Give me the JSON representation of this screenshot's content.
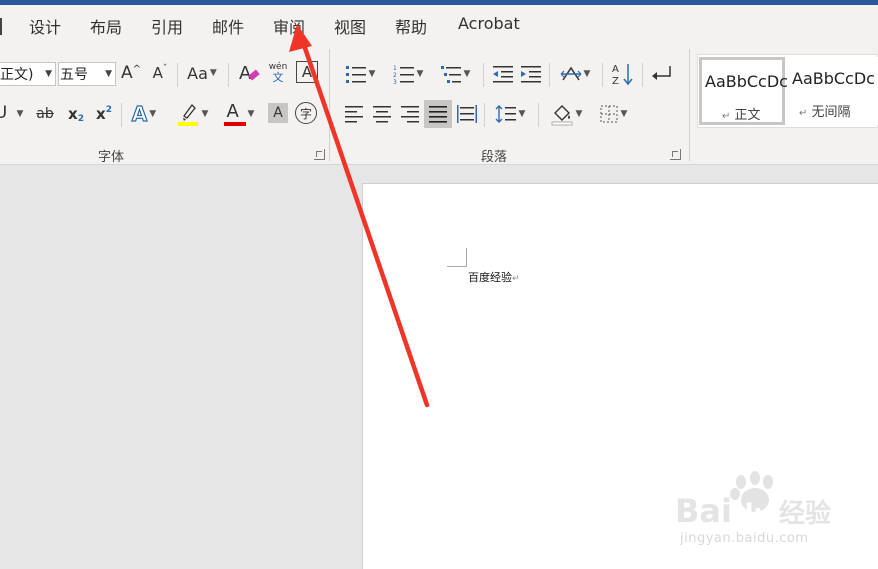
{
  "colors": {
    "accent_bar": "#2b579a",
    "arrow": "#f03428",
    "highlight": "#ffff00",
    "font_color": "#e00000"
  },
  "tabs": [
    {
      "label": "设计"
    },
    {
      "label": "布局"
    },
    {
      "label": "引用"
    },
    {
      "label": "邮件"
    },
    {
      "label": "审阅"
    },
    {
      "label": "视图"
    },
    {
      "label": "帮助"
    },
    {
      "label": "Acrobat"
    }
  ],
  "font_group": {
    "label": "字体",
    "font_name": "正文)",
    "font_size": "五号",
    "change_case": "Aa",
    "phonetic_top": "wén",
    "phonetic_bottom": "文",
    "text_effects": "A",
    "font_color": "A",
    "char_shading": "A",
    "enclose": "字",
    "subscript": "x",
    "superscript": "x",
    "sub_mark": "2",
    "sup_mark": "2",
    "strike": "ab",
    "grow": "A",
    "shrink": "A"
  },
  "paragraph_group": {
    "label": "段落"
  },
  "styles": [
    {
      "sample": "AaBbCcDc",
      "name": "正文",
      "icons": "paragraph-mark-icon"
    },
    {
      "sample": "AaBbCcDc",
      "name": "无间隔",
      "icons": "paragraph-mark-icon"
    }
  ],
  "document": {
    "text": "百度经验",
    "mark": "↵"
  },
  "watermark": {
    "logo_left": "Bai",
    "logo_mid": "du",
    "logo_right": "经验",
    "url": "jingyan.baidu.com"
  }
}
